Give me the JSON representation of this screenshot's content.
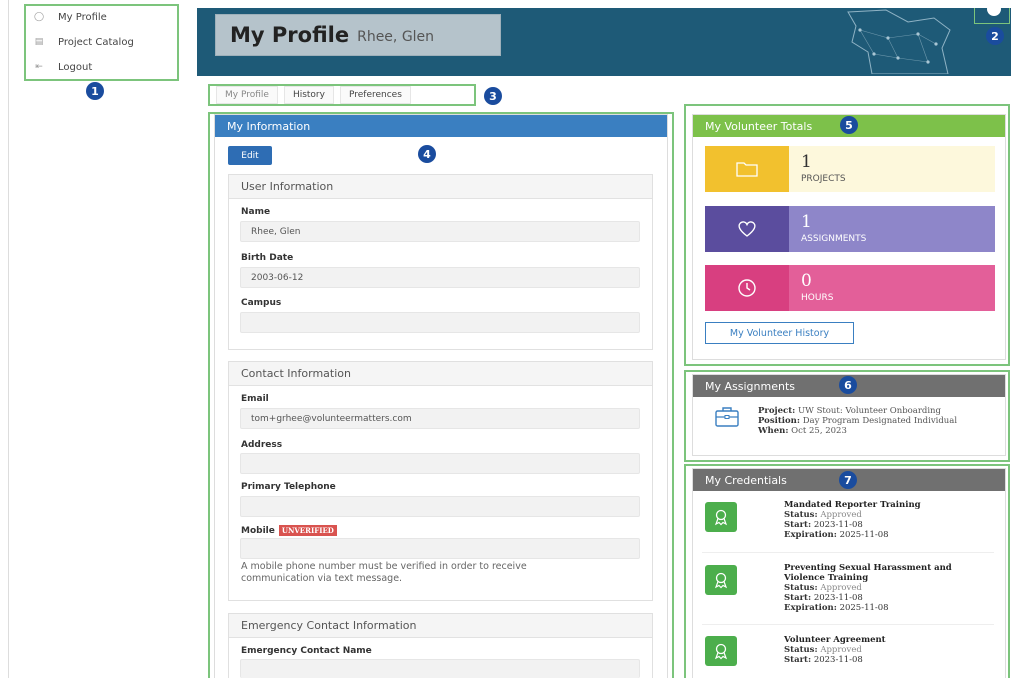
{
  "nav": {
    "items": [
      {
        "label": "My Profile",
        "icon": "profile-icon"
      },
      {
        "label": "Project Catalog",
        "icon": "book-icon"
      },
      {
        "label": "Logout",
        "icon": "logout-icon"
      }
    ]
  },
  "markers": [
    "1",
    "2",
    "3",
    "4",
    "5",
    "6",
    "7"
  ],
  "header": {
    "title": "My Profile",
    "subtitle": "Rhee, Glen",
    "bg_color": "#1e5a77"
  },
  "tabs": [
    "My Profile",
    "History",
    "Preferences"
  ],
  "info": {
    "heading": "My Information",
    "edit_label": "Edit",
    "user_section": "User Information",
    "name_label": "Name",
    "name_value": "Rhee, Glen",
    "birth_label": "Birth Date",
    "birth_value": "2003-06-12",
    "campus_label": "Campus",
    "campus_value": "",
    "contact_section": "Contact Information",
    "email_label": "Email",
    "email_value": "tom+grhee@volunteermatters.com",
    "address_label": "Address",
    "address_value": "",
    "phone_label": "Primary Telephone",
    "phone_value": "",
    "mobile_label": "Mobile",
    "mobile_badge": "UNVERIFIED",
    "mobile_value": "",
    "mobile_note_1": "A mobile phone number must be verified in order to receive",
    "mobile_note_2": "communication via text message.",
    "emergency_section": "Emergency Contact Information",
    "emergency_name_label": "Emergency Contact Name",
    "emergency_name_value": ""
  },
  "totals": {
    "heading": "My Volunteer Totals",
    "stats": [
      {
        "value": "1",
        "label": "PROJECTS",
        "icon": "folder-icon",
        "color": "#f2c12e",
        "bg": "#fdf8dc"
      },
      {
        "value": "1",
        "label": "ASSIGNMENTS",
        "icon": "heart-icon",
        "color": "#5b4d9e",
        "bg": "#8e86c9"
      },
      {
        "value": "0",
        "label": "HOURS",
        "icon": "clock-icon",
        "color": "#d83f80",
        "bg": "#e35f99"
      }
    ],
    "history_button": "My Volunteer History"
  },
  "assignments": {
    "heading": "My Assignments",
    "project_label": "Project:",
    "project_value": "UW Stout: Volunteer Onboarding",
    "position_label": "Position:",
    "position_value": "Day Program Designated Individual",
    "when_label": "When:",
    "when_value": "Oct 25, 2023"
  },
  "credentials": {
    "heading": "My Credentials",
    "status_label": "Status:",
    "start_label": "Start:",
    "expiration_label": "Expiration:",
    "items": [
      {
        "title_1": "Mandated Reporter Training",
        "title_2": "",
        "status": "Approved",
        "start": "2023-11-08",
        "expiration": "2025-11-08"
      },
      {
        "title_1": "Preventing Sexual Harassment and",
        "title_2": "Violence Training",
        "status": "Approved",
        "start": "2023-11-08",
        "expiration": "2025-11-08"
      },
      {
        "title_1": "Volunteer Agreement",
        "title_2": "",
        "status": "Approved",
        "start": "2023-11-08",
        "expiration": ""
      }
    ]
  }
}
